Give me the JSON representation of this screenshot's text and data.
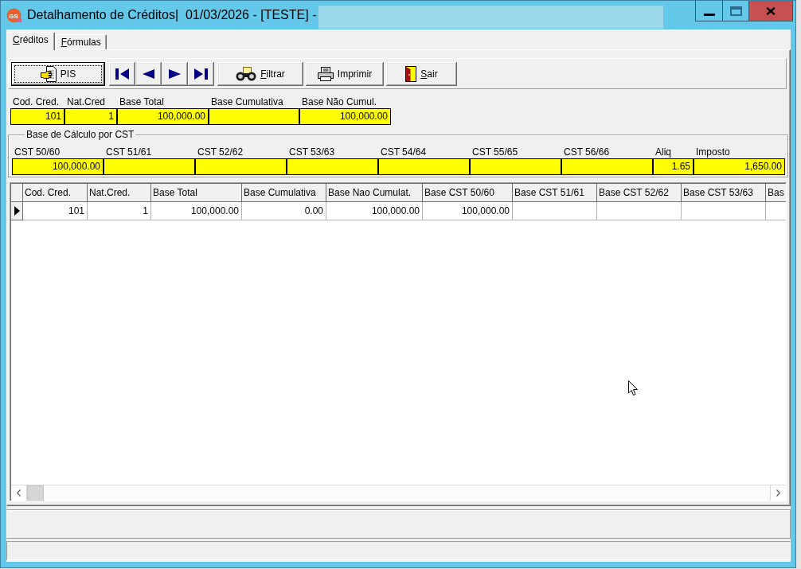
{
  "window": {
    "logo_text": "GS",
    "title": "Detalhamento de Créditos|  01/03/2026 - [TESTE] -"
  },
  "tabs": [
    {
      "label": "Créditos",
      "selected": true,
      "mnemonic": true
    },
    {
      "label": "Fórmulas",
      "selected": false,
      "mnemonic": true
    }
  ],
  "toolbar": [
    {
      "kind": "document",
      "label": "PIS",
      "focused": true,
      "mnemonic": false
    },
    {
      "kind": "first",
      "focused": false
    },
    {
      "kind": "previous",
      "focused": false
    },
    {
      "kind": "next",
      "focused": false
    },
    {
      "kind": "last",
      "focused": false
    },
    {
      "kind": "filter",
      "label": "Filtrar",
      "focused": false,
      "mnemonic": true
    },
    {
      "kind": "print",
      "label": "Imprimir",
      "focused": false,
      "mnemonic": false
    },
    {
      "kind": "exit",
      "label": "Sair",
      "focused": false,
      "mnemonic": true
    }
  ],
  "credit_fields": [
    {
      "label": "Cod. Cred.",
      "value": "101"
    },
    {
      "label": "Nat.Cred",
      "value": "1"
    },
    {
      "label": "Base Total",
      "value": "100,000.00"
    },
    {
      "label": "Base Cumulativa"
    },
    {
      "label": "Base Não Cumul.",
      "value": "100,000.00"
    }
  ],
  "cst_group": {
    "title": "Base de Cálculo por CST",
    "fields": [
      {
        "label": "CST 50/60",
        "value": "100,000.00"
      },
      {
        "label": "CST 51/61"
      },
      {
        "label": "CST 52/62"
      },
      {
        "label": "CST 53/63"
      },
      {
        "label": "CST 54/64"
      },
      {
        "label": "CST 55/65"
      },
      {
        "label": "CST 56/66"
      },
      {
        "label": "Aliq",
        "value": "1.65"
      },
      {
        "label": "Imposto",
        "value": "1,650.00"
      }
    ]
  },
  "grid": {
    "columns": [
      "Cod. Cred.",
      "Nat.Cred.",
      "Base Total",
      "Base Cumulativa",
      "Base Nao Cumulat.",
      "Base CST 50/60",
      "Base CST 51/61",
      "Base CST 52/62",
      "Base CST 53/63",
      "Bas"
    ],
    "rows": [
      {
        "selected": true,
        "cells": [
          "101",
          "1",
          "100,000.00",
          "0.00",
          "100,000.00",
          "100,000.00"
        ]
      }
    ]
  }
}
